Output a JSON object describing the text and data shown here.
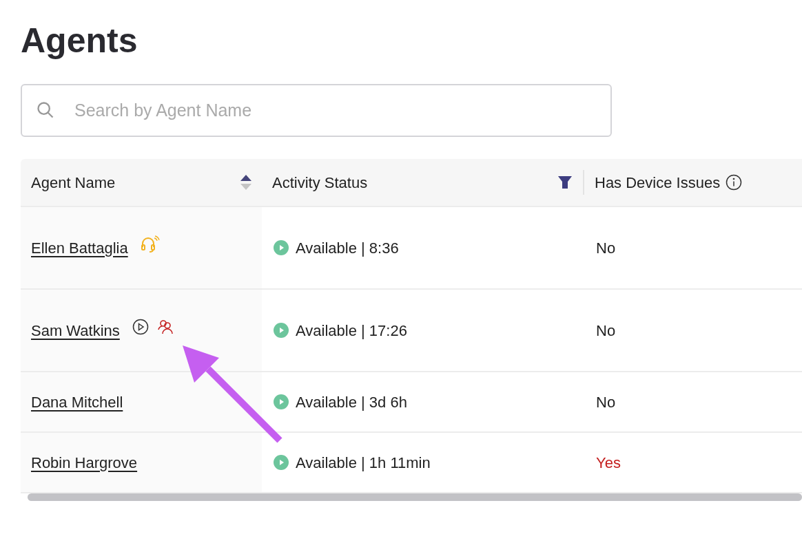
{
  "title": "Agents",
  "search": {
    "placeholder": "Search by Agent Name"
  },
  "table": {
    "columns": [
      {
        "label": "Agent Name",
        "kind": "sort"
      },
      {
        "label": "Activity Status",
        "kind": "filter"
      },
      {
        "label": "Has Device Issues",
        "kind": "info"
      }
    ],
    "rows": [
      {
        "name": "Ellen Battaglia",
        "icons": [
          {
            "kind": "headset"
          }
        ],
        "status": "Available | 8:36",
        "device_issues": "No",
        "has_issue": false
      },
      {
        "name": "Sam Watkins",
        "icons": [
          {
            "kind": "play"
          },
          {
            "kind": "people"
          }
        ],
        "status": "Available | 17:26",
        "device_issues": "No",
        "has_issue": false
      },
      {
        "name": "Dana Mitchell",
        "status": "Available | 3d 6h",
        "device_issues": "No",
        "has_issue": false
      },
      {
        "name": "Robin Hargrove",
        "status": "Available | 1h 11min",
        "device_issues": "Yes",
        "has_issue": true
      }
    ]
  }
}
